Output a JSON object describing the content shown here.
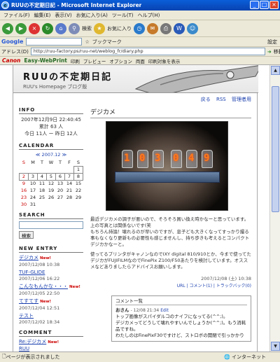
{
  "window": {
    "title": "RUUの不定期日記 - Microsoft Internet Explorer",
    "icon": "ie-icon",
    "min": "_",
    "max": "□",
    "close": "×"
  },
  "menu": [
    "ファイル(F)",
    "編集(E)",
    "表示(V)",
    "お気に入り(A)",
    "ツール(T)",
    "ヘルプ(H)"
  ],
  "toolbar": {
    "search_label": "検索",
    "favorites_label": "お気に入り"
  },
  "google_bar": {
    "logo": "Google",
    "bookmark_label": "ブックマーク",
    "settings_label": "設定"
  },
  "address": {
    "label": "アドレス(D)",
    "url": "http://ruu-factory.ps/ruu-net/weblog_fr/diary.php",
    "go_label": "移動"
  },
  "canon_bar": {
    "brand": "Canon",
    "product": "Easy-WebPrint",
    "print": "印刷",
    "print_preview": "プレビュー",
    "options": "オプション",
    "both": "両面",
    "print_range": "印刷対象を表示"
  },
  "blog": {
    "title": "RUUの不定期日記",
    "subtitle": "RUU's Homepage ブログ版",
    "top_links": [
      "戻る",
      "RSS",
      "管理者用"
    ],
    "info_header": "INFO",
    "info_lines": [
      "2007年12月9日 22:40:45",
      "累計 63 人",
      "今日 11人 ー 昨日 12人"
    ],
    "calendar_header": "CALENDAR",
    "calendar_nav": "≪ 2007.12 ≫",
    "calendar_days": [
      "S",
      "M",
      "T",
      "W",
      "T",
      "F",
      "S"
    ],
    "calendar_weeks": [
      [
        "",
        "",
        "",
        "",
        "",
        "",
        "1"
      ],
      [
        "2",
        "3",
        "4",
        "5",
        "6",
        "7",
        "8"
      ],
      [
        "9",
        "10",
        "11",
        "12",
        "13",
        "14",
        "15"
      ],
      [
        "16",
        "17",
        "18",
        "19",
        "20",
        "21",
        "22"
      ],
      [
        "23",
        "24",
        "25",
        "26",
        "27",
        "28",
        "29"
      ],
      [
        "30",
        "31",
        "",
        "",
        "",
        "",
        ""
      ]
    ],
    "search_header": "SEARCH",
    "search_button": "検索",
    "new_entry_header": "NEW ENTRY",
    "new_entries": [
      {
        "title": "デジカメ",
        "date": "2007/12/08 10:38",
        "is_new": true
      },
      {
        "title": "TUF-GLIDE",
        "date": "2007/12/06 16:22",
        "is_new": false
      },
      {
        "title": "こんなもんかな・・・",
        "date": "2007/12/05 22:50",
        "is_new": true
      },
      {
        "title": "てすてす",
        "date": "2007/12/04 12:51",
        "is_new": true
      },
      {
        "title": "テスト",
        "date": "2007/12/02 18:34",
        "is_new": false
      }
    ],
    "new_label": "New!",
    "comment_header": "COMMENT",
    "recent_comments": [
      {
        "title": "Re:デジカメ",
        "is_new": true
      },
      {
        "title": "RUU",
        "is_new": false
      }
    ],
    "post": {
      "title": "デジカメ",
      "photo_digits": [
        "1",
        "0",
        "3",
        "0",
        "4",
        "9"
      ],
      "body_1": "最近デジカメの調子が悪いので、そろそろ買い換え時かなーと思っています。上の写真とは関係ないです(笑",
      "body_2": "もちろん持論！壊れるのが早いのですが、息子ども大きくなってすっかり撮る事もなくなり更新もの必要性も感じませんし、持ち歩きも考えるとコンパクトデジカかなーと。",
      "body_3": "使ってるプリンタがキャノンなのでIXY digital 810/910とか、今まで使ってたデジカがFUJIFILMなのでFinePix Z100/F50あたりを検討しています。オススメなどありましたらアドバイスお願いします。",
      "date": "2007/12/08 (土) 10:38",
      "links": "URL | コメント(1) | トラックバック(0)"
    },
    "comments_header": "コメント一覧",
    "comment": {
      "author": "おさん",
      "date": "- 12/08 21:34",
      "edit": "Edit",
      "lines": [
        "トップ画像がスパイダルコのナイフになってる(^^;)。",
        "デジカメってどうして壊れやすいんでしょうか(^^;)。もう消耗品ですね。",
        "わたしのはFinePixF30ですけど、ストロボの開閉で引っかかり"
      ]
    }
  },
  "status": {
    "text": "ページが表示されました",
    "zone": "インターネット"
  }
}
